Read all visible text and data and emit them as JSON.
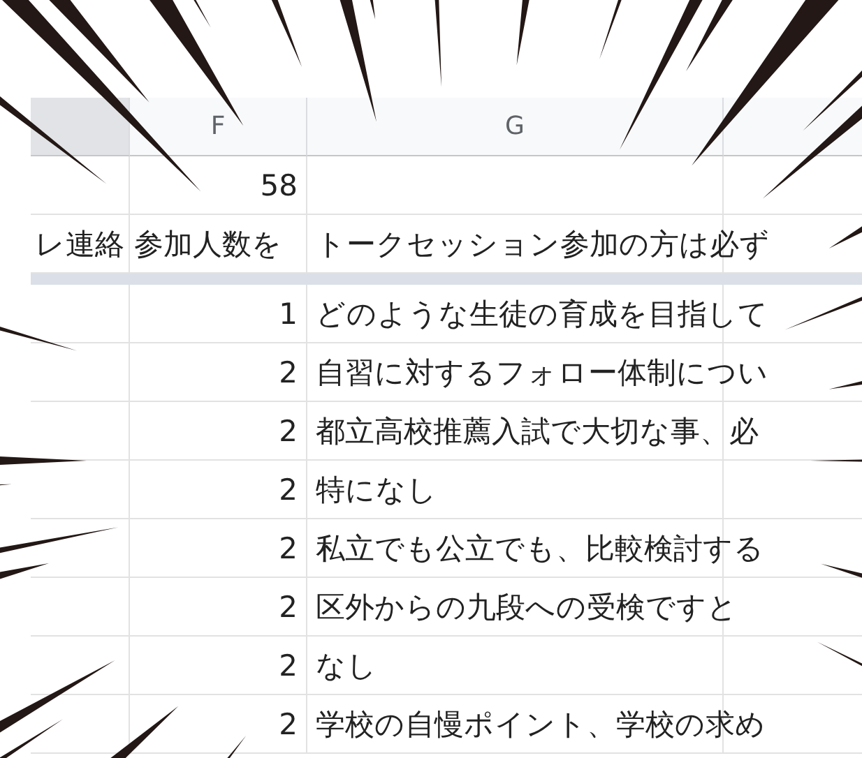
{
  "column_headers": [
    {
      "label": "F"
    },
    {
      "label": "G"
    }
  ],
  "rows": [
    {
      "column_e": "",
      "column_f": "58",
      "column_g": "",
      "kind": "plain"
    },
    {
      "column_e": "レ連絡",
      "column_f": "参加人数を",
      "column_g": "トークセッション参加の方は必ず",
      "kind": "header"
    },
    {
      "column_e": "",
      "column_f": "1",
      "column_g": "どのような生徒の育成を目指して",
      "kind": "plain"
    },
    {
      "column_e": "",
      "column_f": "2",
      "column_g": "自習に対するフォロー体制につい",
      "kind": "plain"
    },
    {
      "column_e": "",
      "column_f": "2",
      "column_g": "都立高校推薦入試で大切な事、必",
      "kind": "plain"
    },
    {
      "column_e": "",
      "column_f": "2",
      "column_g": "特になし",
      "kind": "plain"
    },
    {
      "column_e": "",
      "column_f": "2",
      "column_g": "私立でも公立でも、比較検討する",
      "kind": "plain"
    },
    {
      "column_e": "",
      "column_f": "2",
      "column_g": "区外からの九段への受検ですと",
      "kind": "plain"
    },
    {
      "column_e": "",
      "column_f": "2",
      "column_g": "なし",
      "kind": "plain"
    },
    {
      "column_e": "",
      "column_f": "2",
      "column_g": "学校の自慢ポイント、学校の求め",
      "kind": "plain"
    }
  ]
}
